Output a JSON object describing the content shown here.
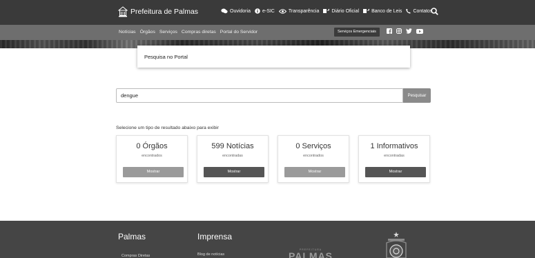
{
  "header": {
    "brand": "Prefeitura de Palmas",
    "nav": [
      {
        "label": "Ouvidoria",
        "icon": "chat-icon"
      },
      {
        "label": "e-SIC",
        "icon": "info-icon"
      },
      {
        "label": "Transparência",
        "icon": "eye-icon"
      },
      {
        "label": "Diário Oficial",
        "icon": "book-icon"
      },
      {
        "label": "Banco de Leis",
        "icon": "book-icon"
      },
      {
        "label": "Contatos",
        "icon": "phone-icon"
      }
    ]
  },
  "subnav": {
    "items": [
      "Notícias",
      "Órgãos",
      "Serviços",
      "Compras diretas",
      "Portal do Servidor"
    ],
    "emergency": "Serviços Emergenciais",
    "social": [
      "facebook-icon",
      "instagram-icon",
      "twitter-icon",
      "youtube-icon"
    ]
  },
  "portal": {
    "title": "Pesquisa no Portal"
  },
  "search": {
    "value": "dengue",
    "button": "Pesquisar"
  },
  "results": {
    "label": "Selecione um tipo de resultado abaixo para exibir",
    "cards": [
      {
        "title": "0 Órgãos",
        "sub": "encontrados",
        "button": "Mostrar",
        "enabled": false
      },
      {
        "title": "599 Notícias",
        "sub": "encontradas",
        "button": "Mostrar",
        "enabled": true
      },
      {
        "title": "0 Serviços",
        "sub": "encontrados",
        "button": "Mostrar",
        "enabled": false
      },
      {
        "title": "1 Informativos",
        "sub": "encontradas",
        "button": "Mostrar",
        "enabled": true
      }
    ]
  },
  "footer": {
    "col1": {
      "heading": "Palmas",
      "link": "Compras Diretas"
    },
    "col2": {
      "heading": "Imprensa",
      "link": "Blog de notícias"
    },
    "logo_small": "PREFEITURA",
    "logo_big": "PALMAS"
  },
  "colors": {
    "topbar": "#3a3a3a",
    "subbar": "#6e6e6e",
    "button_enabled": "#555555",
    "button_disabled": "#9a9a9a",
    "footer": "#454545"
  }
}
